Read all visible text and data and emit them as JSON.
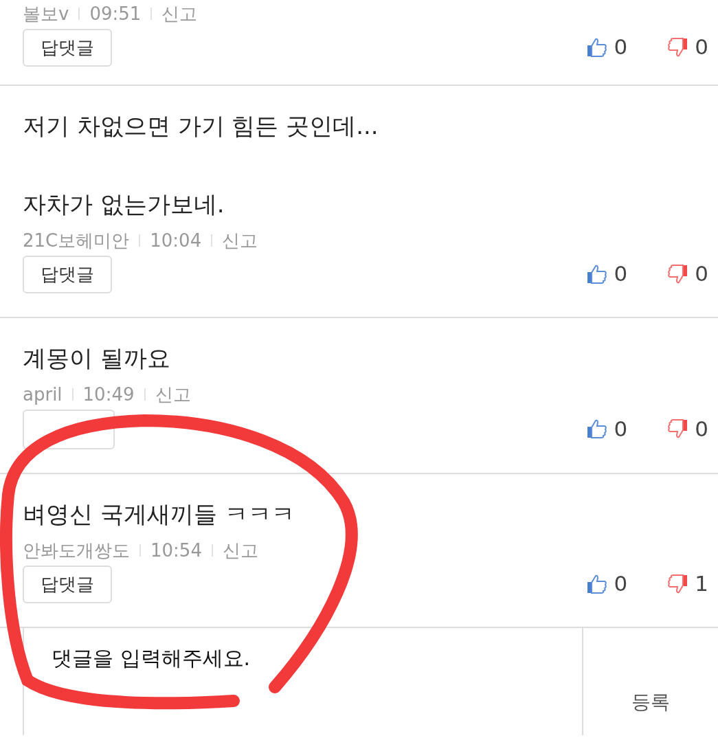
{
  "comments": [
    {
      "author": "볼보v",
      "time": "09:51",
      "report": "신고",
      "reply": "답댓글",
      "likes": "0",
      "dislikes": "0"
    },
    {
      "text": "저기 차없으면 가기 힘든 곳인데...\n\n자차가 없는가보네.",
      "author": "21C보헤미안",
      "time": "10:04",
      "report": "신고",
      "reply": "답댓글",
      "likes": "0",
      "dislikes": "0"
    },
    {
      "text": "계몽이 될까요",
      "author": "april",
      "time": "10:49",
      "report": "신고",
      "likes": "0",
      "dislikes": "0"
    },
    {
      "text": "벼영신 국게새끼들 ㅋㅋㅋ",
      "author": "안봐도개쌍도",
      "time": "10:54",
      "report": "신고",
      "reply": "답댓글",
      "likes": "0",
      "dislikes": "1"
    }
  ],
  "composer": {
    "placeholder": "댓글을 입력해주세요.",
    "submit": "등록"
  }
}
